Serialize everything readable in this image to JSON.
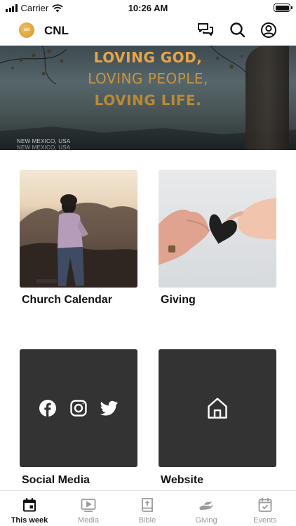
{
  "status_bar": {
    "carrier": "Carrier",
    "time": "10:26 AM"
  },
  "header": {
    "logo_text": "cnl",
    "title": "CNL"
  },
  "banner": {
    "line1": "LOVING GOD,",
    "line2": "LOVING PEOPLE,",
    "line3": "LOVING LIFE.",
    "caption": "NEW MEXICO, USA",
    "caption_echo": "NEW MEXICO, USA"
  },
  "tiles": [
    {
      "label": "Church Calendar",
      "image": "woman-on-hill-photo"
    },
    {
      "label": "Giving",
      "image": "hands-giving-heart-photo"
    },
    {
      "label": "Social Media",
      "icons": [
        "facebook-icon",
        "instagram-icon",
        "twitter-icon"
      ]
    },
    {
      "label": "Website",
      "icons": [
        "home-icon"
      ]
    }
  ],
  "tab_bar": {
    "active": "This week",
    "tabs": [
      {
        "label": "This week",
        "icon": "calendar-icon"
      },
      {
        "label": "Media",
        "icon": "play-icon"
      },
      {
        "label": "Bible",
        "icon": "bible-icon"
      },
      {
        "label": "Giving",
        "icon": "giving-icon"
      },
      {
        "label": "Events",
        "icon": "event-check-icon"
      }
    ]
  },
  "colors": {
    "accent": "#e8a447",
    "tile_dark": "#333333",
    "tab_inactive": "#9a9a9a"
  }
}
